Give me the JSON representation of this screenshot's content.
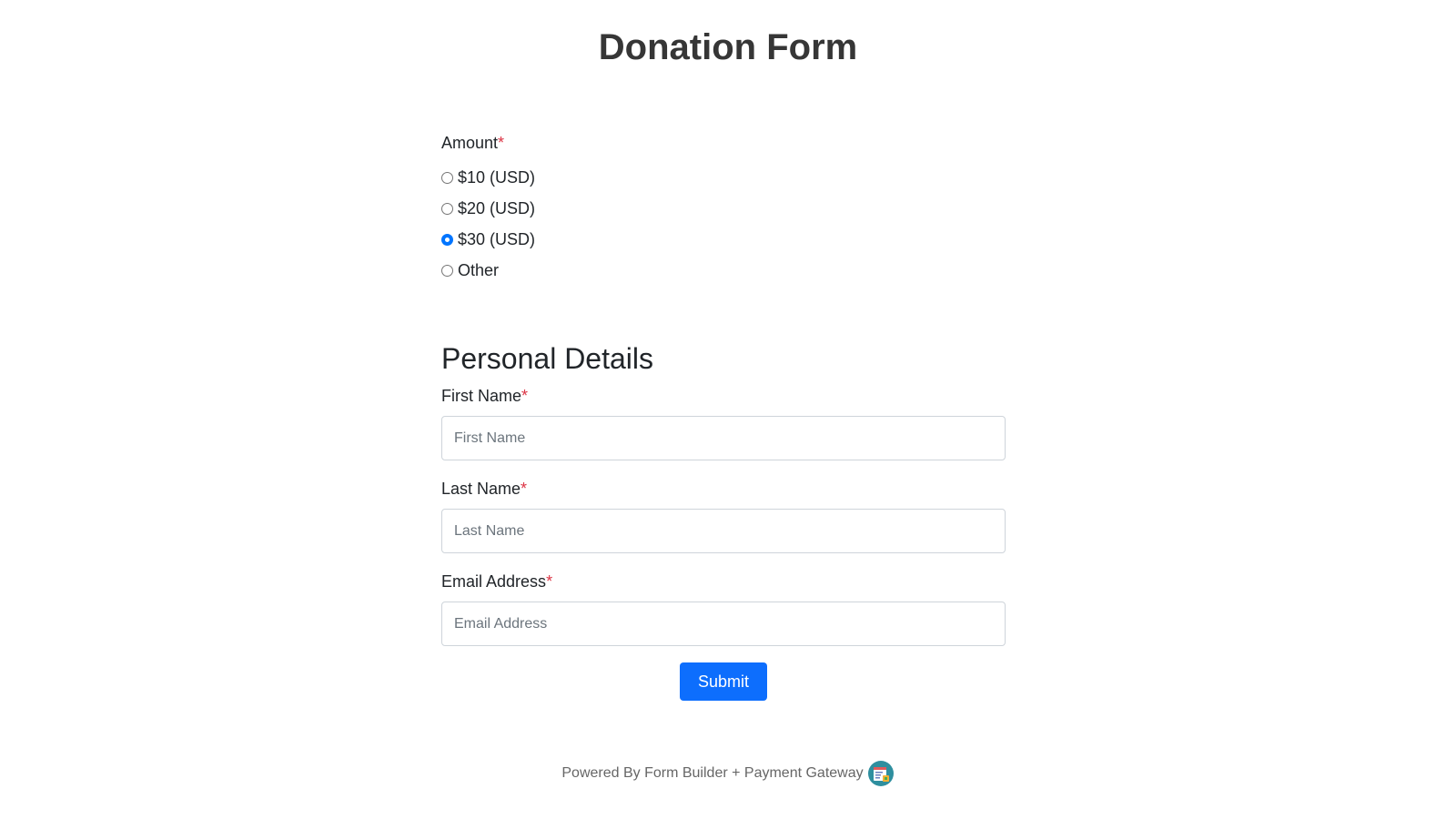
{
  "form": {
    "title": "Donation Form"
  },
  "amount": {
    "label": "Amount",
    "required_mark": "*",
    "options": [
      {
        "label": "$10 (USD)",
        "selected": false
      },
      {
        "label": "$20 (USD)",
        "selected": false
      },
      {
        "label": "$30 (USD)",
        "selected": true
      },
      {
        "label": "Other",
        "selected": false
      }
    ]
  },
  "personal": {
    "heading": "Personal Details",
    "first_name": {
      "label": "First Name",
      "required_mark": "*",
      "placeholder": "First Name",
      "value": ""
    },
    "last_name": {
      "label": "Last Name",
      "required_mark": "*",
      "placeholder": "Last Name",
      "value": ""
    },
    "email": {
      "label": "Email Address",
      "required_mark": "*",
      "placeholder": "Email Address",
      "value": ""
    }
  },
  "submit": {
    "label": "Submit"
  },
  "footer": {
    "text": "Powered By Form Builder + Payment Gateway",
    "logo_icon": "form-builder-logo-icon"
  },
  "colors": {
    "primary": "#0d6efd",
    "required": "#dc3545",
    "radio_checked": "#0075ff"
  }
}
